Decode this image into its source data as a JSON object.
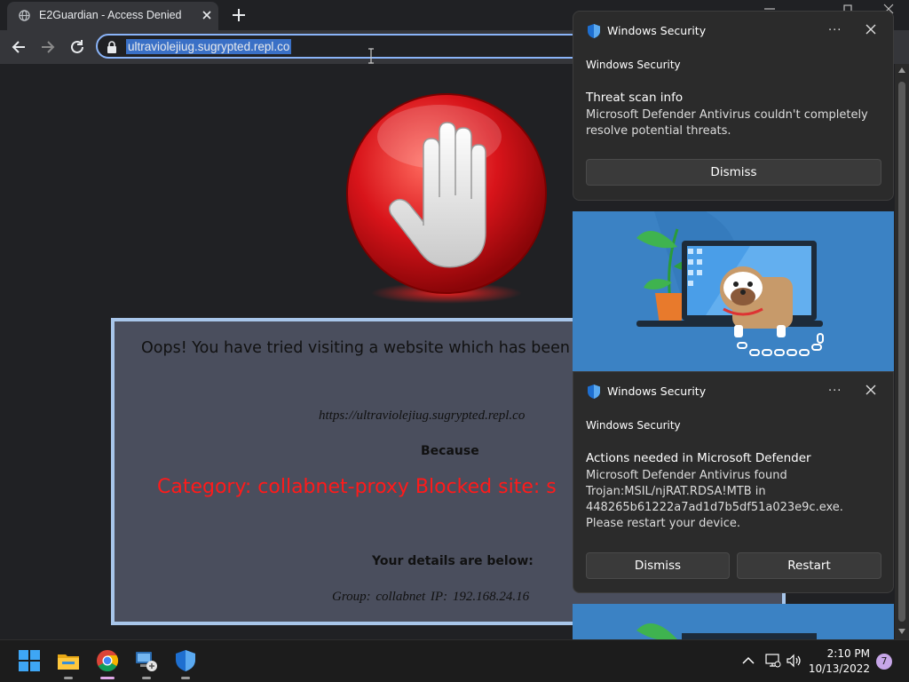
{
  "browser": {
    "tab_title": "E2Guardian - Access Denied",
    "url": "ultraviolejiug.sugrypted.repl.co"
  },
  "page": {
    "message": "Oops! You have tried visiting a website which has been",
    "blocked_url": "https://ultraviolejiug.sugrypted.repl.co",
    "because": "Because",
    "category_line": "Category: collabnet-proxy  Blocked site: s",
    "details_heading": "Your details are below:",
    "group_line": "Group: collabnet    IP: 192.168.24.16"
  },
  "notifications": [
    {
      "app": "Windows Security",
      "more": "···",
      "attribution": "Windows Security",
      "heading": "Threat scan info",
      "body": "Microsoft Defender Antivirus couldn't completely resolve potential threats.",
      "buttons": [
        "Dismiss"
      ]
    },
    {
      "app": "Windows Security",
      "more": "···",
      "attribution": "Windows Security",
      "heading": "Actions needed in Microsoft Defender",
      "body": "Microsoft Defender Antivirus found Trojan:MSIL/njRAT.RDSA!MTB in 448265b61222a7ad1d7b5df51a023e9c.exe. Please restart your device.",
      "buttons": [
        "Dismiss",
        "Restart"
      ]
    }
  ],
  "taskbar": {
    "apps": [
      "start-icon",
      "file-explorer-icon",
      "chrome-icon",
      "remote-desktop-icon",
      "windows-security-icon"
    ],
    "time": "2:10 PM",
    "date": "10/13/2022",
    "notification_count": "7"
  },
  "colors": {
    "category_red": "#ff1a1a",
    "panel_bg": "#4a4e5d",
    "omnibox_focus": "#8ab4f8",
    "accent_blue": "#3b82c4"
  }
}
